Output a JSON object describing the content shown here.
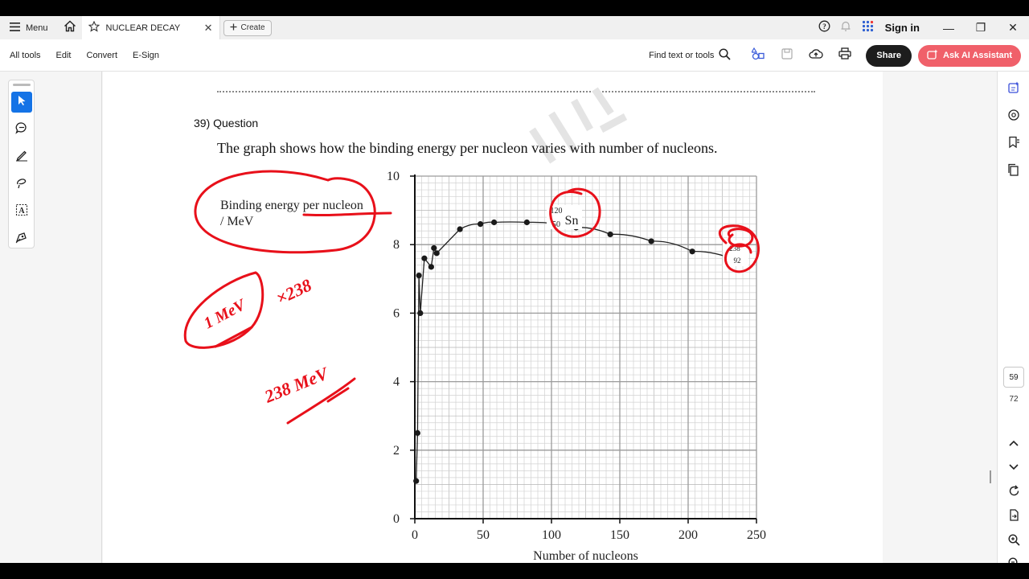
{
  "titlebar": {
    "menu_label": "Menu",
    "tab_title": "NUCLEAR DECAY",
    "tab_close": "✕",
    "create_label": "Create",
    "signin_label": "Sign in",
    "window_minimize": "—",
    "window_restore": "❐",
    "window_close": "✕"
  },
  "toolbar": {
    "menu_items": [
      "All tools",
      "Edit",
      "Convert",
      "E-Sign"
    ],
    "find_label": "Find text or tools",
    "share_label": "Share",
    "ai_label": "Ask AI Assistant"
  },
  "document": {
    "question_title": "39) Question",
    "question_text": "The graph shows how the binding energy per nucleon varies with number of nucleons.",
    "ylabel_line1": "Binding energy per nucleon",
    "ylabel_line2": "/ MeV",
    "xlabel": "Number of nucleons",
    "sn_mass": "120",
    "sn_atomic": "50",
    "sn_symbol": "Sn",
    "u_mass": "238",
    "u_atomic": "92",
    "handwriting_1": "1 MeV",
    "handwriting_2": "×238",
    "handwriting_3": "238 MeV"
  },
  "page_nav": {
    "current_page": "59",
    "total_pages": "72"
  },
  "colors": {
    "accent_blue": "#1473e6",
    "ai_button": "#f0606a",
    "ink_red": "#e8101a"
  },
  "chart_data": {
    "type": "scatter",
    "xlabel": "Number of nucleons",
    "ylabel": "Binding energy per nucleon / MeV",
    "xlim": [
      0,
      250
    ],
    "ylim": [
      0,
      10
    ],
    "xticks": [
      0,
      50,
      100,
      150,
      200,
      250
    ],
    "yticks": [
      0,
      2,
      4,
      6,
      8,
      10
    ],
    "grid": true,
    "points": [
      {
        "x": 1,
        "y": 1.1
      },
      {
        "x": 2,
        "y": 2.5
      },
      {
        "x": 3,
        "y": 7.1
      },
      {
        "x": 4,
        "y": 6.0
      },
      {
        "x": 7,
        "y": 7.6
      },
      {
        "x": 12,
        "y": 7.35
      },
      {
        "x": 14,
        "y": 7.9
      },
      {
        "x": 16,
        "y": 7.75
      },
      {
        "x": 33,
        "y": 8.45
      },
      {
        "x": 48,
        "y": 8.6
      },
      {
        "x": 58,
        "y": 8.65
      },
      {
        "x": 82,
        "y": 8.65
      },
      {
        "x": 118,
        "y": 8.5
      },
      {
        "x": 143,
        "y": 8.3
      },
      {
        "x": 173,
        "y": 8.1
      },
      {
        "x": 203,
        "y": 7.8
      },
      {
        "x": 237,
        "y": 7.5
      }
    ]
  }
}
